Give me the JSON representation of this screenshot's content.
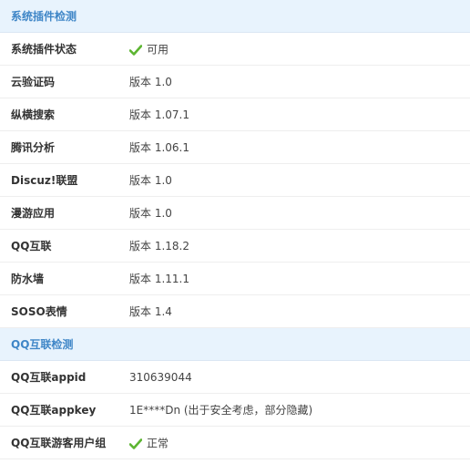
{
  "sections": [
    {
      "title": "系统插件检测",
      "rows": [
        {
          "label": "系统插件状态",
          "value": "可用",
          "icon": "check-icon",
          "status_color": "#5cb531"
        },
        {
          "label": "云验证码",
          "value": "版本 1.0"
        },
        {
          "label": "纵横搜索",
          "value": "版本 1.07.1"
        },
        {
          "label": "腾讯分析",
          "value": "版本 1.06.1"
        },
        {
          "label": "Discuz!联盟",
          "value": "版本 1.0"
        },
        {
          "label": "漫游应用",
          "value": "版本 1.0"
        },
        {
          "label": "QQ互联",
          "value": "版本 1.18.2"
        },
        {
          "label": "防水墙",
          "value": "版本 1.11.1"
        },
        {
          "label": "SOSO表情",
          "value": "版本 1.4"
        }
      ]
    },
    {
      "title": "QQ互联检测",
      "rows": [
        {
          "label": "QQ互联appid",
          "value": "310639044"
        },
        {
          "label": "QQ互联appkey",
          "value": "1E****Dn (出于安全考虑，部分隐藏)"
        },
        {
          "label": "QQ互联游客用户组",
          "value": "正常",
          "icon": "check-icon",
          "status_color": "#5cb531"
        }
      ]
    }
  ],
  "colors": {
    "header_bg": "#e8f3fd",
    "header_text": "#3f86c7",
    "check_green": "#5cb531"
  }
}
